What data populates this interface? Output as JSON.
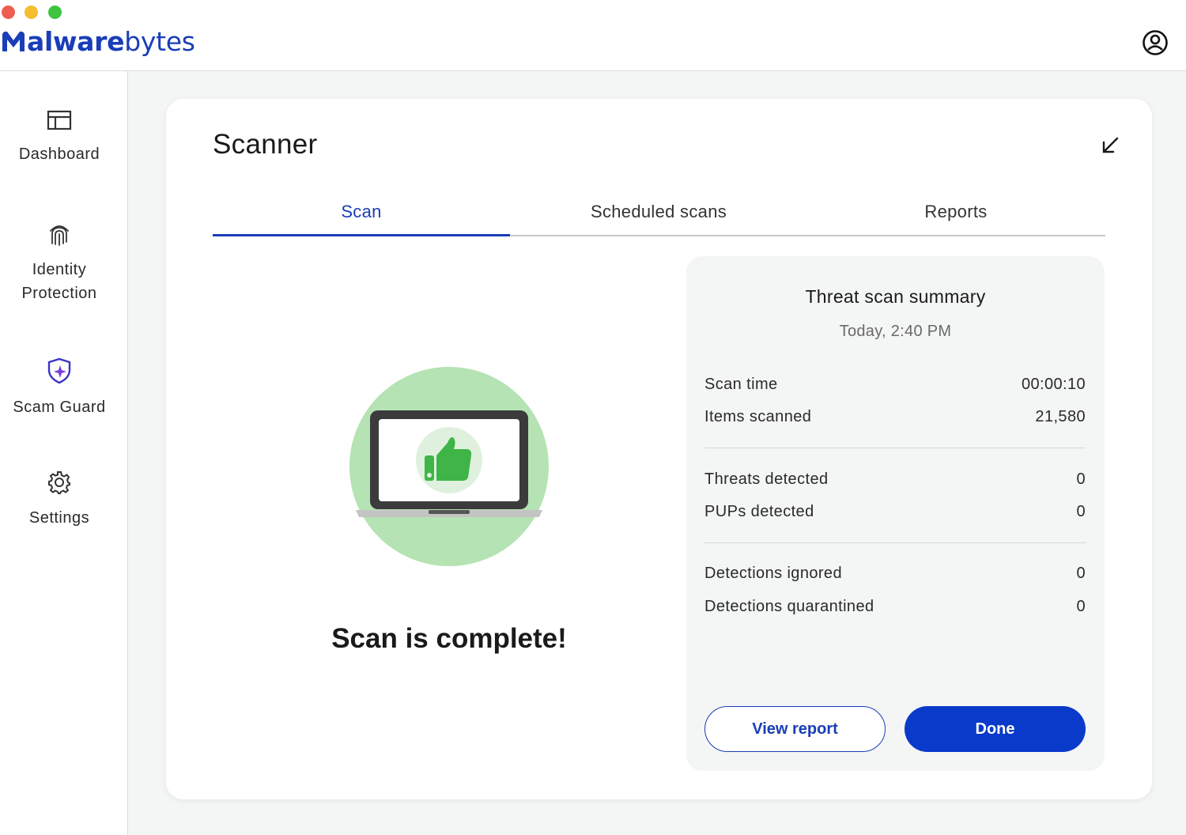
{
  "app": {
    "logo_bold": "alware",
    "logo_light": "bytes"
  },
  "sidebar": {
    "items": [
      {
        "label": "Dashboard",
        "icon": "dashboard-icon"
      },
      {
        "label": "Identity Protection",
        "icon": "fingerprint-icon"
      },
      {
        "label": "Scam Guard",
        "icon": "shield-sparkle-icon"
      },
      {
        "label": "Settings",
        "icon": "gear-icon"
      }
    ]
  },
  "scanner": {
    "title": "Scanner",
    "tabs": [
      {
        "label": "Scan",
        "active": true
      },
      {
        "label": "Scheduled scans",
        "active": false
      },
      {
        "label": "Reports",
        "active": false
      }
    ],
    "status": "Scan is complete!"
  },
  "summary": {
    "title": "Threat scan summary",
    "date": "Today, 2:40 PM",
    "rows": [
      {
        "label": "Scan time",
        "value": "00:00:10"
      },
      {
        "label": "Items scanned",
        "value": "21,580"
      },
      {
        "label": "Threats detected",
        "value": "0"
      },
      {
        "label": "PUPs detected",
        "value": "0"
      },
      {
        "label": "Detections ignored",
        "value": "0"
      },
      {
        "label": "Detections quarantined",
        "value": "0"
      }
    ],
    "view_report_label": "View report",
    "done_label": "Done"
  },
  "colors": {
    "brand": "#1a3db8",
    "primary_button": "#0a3ac9",
    "success_circle": "#b5e3b3",
    "thumbs_up": "#3fb548"
  }
}
